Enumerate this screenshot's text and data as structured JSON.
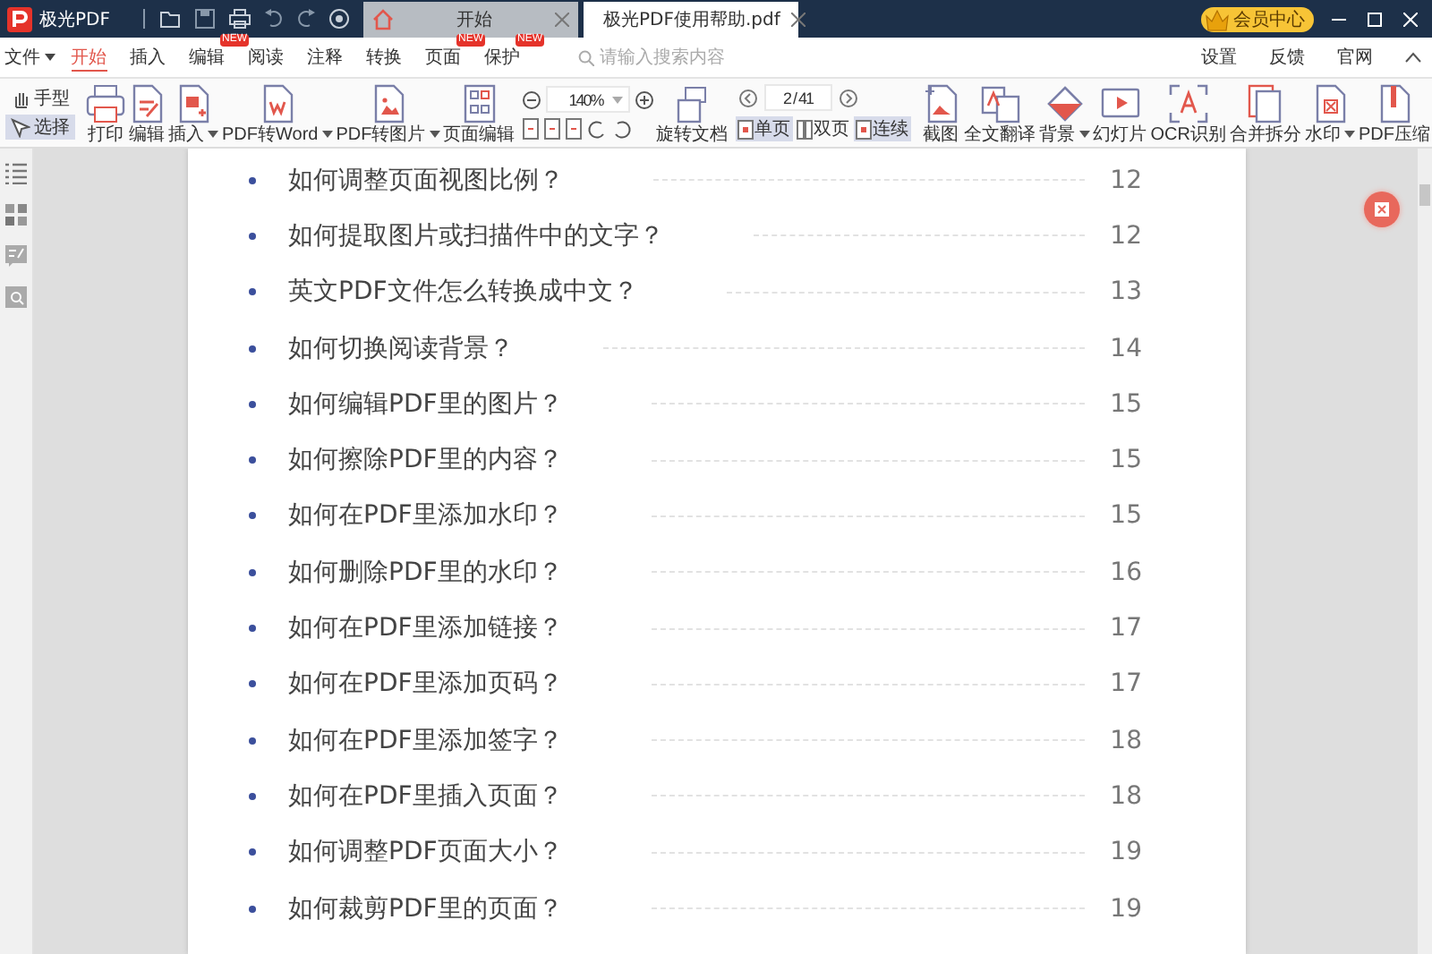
{
  "app": {
    "name": "极光PDF"
  },
  "tabs": [
    {
      "label": "开始",
      "selected": false
    },
    {
      "label": "极光PDF使用帮助.pdf",
      "selected": true
    }
  ],
  "vip": {
    "label": "会员中心"
  },
  "menu": [
    {
      "label": "文件",
      "dropdown": true,
      "selected": false
    },
    {
      "label": "开始",
      "dropdown": false,
      "selected": true
    },
    {
      "label": "插入",
      "dropdown": false,
      "selected": false
    },
    {
      "label": "编辑",
      "dropdown": false,
      "selected": false,
      "badge": "NEW"
    },
    {
      "label": "阅读",
      "dropdown": false,
      "selected": false
    },
    {
      "label": "注释",
      "dropdown": false,
      "selected": false
    },
    {
      "label": "转换",
      "dropdown": false,
      "selected": false
    },
    {
      "label": "页面",
      "dropdown": false,
      "selected": false,
      "badge": "NEW"
    },
    {
      "label": "保护",
      "dropdown": false,
      "selected": false,
      "badge": "NEW"
    }
  ],
  "search": {
    "placeholder": "请输入搜索内容"
  },
  "links": [
    "设置",
    "反馈",
    "官网"
  ],
  "tool_modes": [
    {
      "label": "手型",
      "selected": false
    },
    {
      "label": "选择",
      "selected": true
    }
  ],
  "tools_left": [
    {
      "label": "打印",
      "dropdown": false
    },
    {
      "label": "编辑",
      "dropdown": false
    },
    {
      "label": "插入",
      "dropdown": true
    },
    {
      "label": "PDF转Word",
      "dropdown": true
    },
    {
      "label": "PDF转图片",
      "dropdown": true
    },
    {
      "label": "页面编辑",
      "dropdown": false
    }
  ],
  "zoom": {
    "value": "140%"
  },
  "rotate": {
    "label": "旋转文档"
  },
  "page_nav": {
    "value": "2 / 41"
  },
  "view_modes": [
    {
      "label": "单页",
      "selected": true
    },
    {
      "label": "双页",
      "selected": false
    },
    {
      "label": "连续",
      "selected": true
    }
  ],
  "tools_right": [
    {
      "label": "截图",
      "dropdown": false
    },
    {
      "label": "全文翻译",
      "dropdown": false
    },
    {
      "label": "背景",
      "dropdown": true
    },
    {
      "label": "幻灯片",
      "dropdown": false
    },
    {
      "label": "OCR识别",
      "dropdown": false
    },
    {
      "label": "合并拆分",
      "dropdown": false
    },
    {
      "label": "水印",
      "dropdown": true
    },
    {
      "label": "PDF压缩",
      "dropdown": false
    }
  ],
  "toc": [
    {
      "title": "如何调整页面视图比例？",
      "page": "12"
    },
    {
      "title": "如何提取图片或扫描件中的文字？",
      "page": "12"
    },
    {
      "title": "英文PDF文件怎么转换成中文？",
      "page": "13"
    },
    {
      "title": "如何切换阅读背景？",
      "page": "14"
    },
    {
      "title": "如何编辑PDF里的图片？",
      "page": "15"
    },
    {
      "title": "如何擦除PDF里的内容？",
      "page": "15"
    },
    {
      "title": "如何在PDF里添加水印？",
      "page": "15"
    },
    {
      "title": "如何删除PDF里的水印？",
      "page": "16"
    },
    {
      "title": "如何在PDF里添加链接？",
      "page": "17"
    },
    {
      "title": "如何在PDF里添加页码？",
      "page": "17"
    },
    {
      "title": "如何在PDF里添加签字？",
      "page": "18"
    },
    {
      "title": "如何在PDF里插入页面？",
      "page": "18"
    },
    {
      "title": "如何调整PDF页面大小？",
      "page": "19"
    },
    {
      "title": "如何裁剪PDF里的页面？",
      "page": "19"
    }
  ]
}
